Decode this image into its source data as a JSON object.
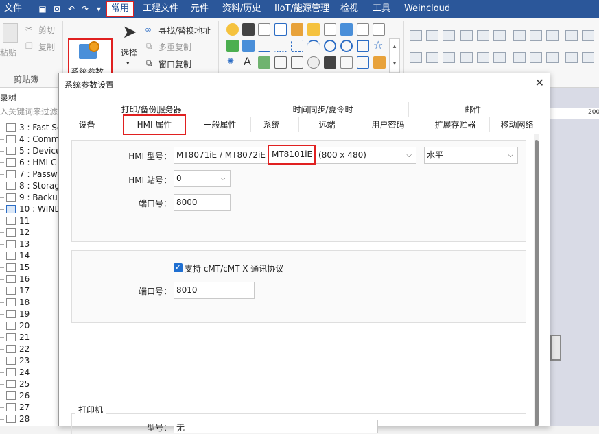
{
  "menubar": {
    "items": [
      "文件",
      "常用",
      "工程文件",
      "元件",
      "资料/历史",
      "IIoT/能源管理",
      "检视",
      "工具",
      "Weincloud"
    ]
  },
  "ribbon": {
    "clipboard": {
      "paste": "粘贴",
      "cut": "剪切",
      "copy": "复制",
      "group_label": "剪贴簿"
    },
    "system_params_button": "系统参数",
    "select_button": "选择",
    "find_replace": "寻找/替换地址",
    "multi_copy": "多重复制",
    "window_copy": "窗口复制"
  },
  "tree": {
    "title": "录树",
    "filter_placeholder": "入关键词来过滤窗",
    "items": [
      "3 : Fast Se",
      "4 : Comm",
      "5 : Device",
      "6 : HMI C",
      "7 : Passwo",
      "8 : Storag",
      "9 : Backup",
      "10 : WIND",
      "11",
      "12",
      "13",
      "14",
      "15",
      "16",
      "17",
      "18",
      "19",
      "20",
      "21",
      "22",
      "23",
      "24",
      "25",
      "26",
      "27",
      "28"
    ]
  },
  "ruler_number": "200",
  "dialog": {
    "title": "系统参数设置",
    "tabs_top": [
      "打印/备份服务器",
      "时间同步/夏令时",
      "邮件"
    ],
    "tabs_bottom": [
      "设备",
      "HMI 属性",
      "一般属性",
      "系统",
      "远端",
      "用户密码",
      "扩展存贮器",
      "移动网络"
    ],
    "hmi_model_label": "HMI 型号：",
    "hmi_model_value": "MT8071iE / MT8072iE / ",
    "hmi_model_highlight": "MT8101iE",
    "hmi_model_suffix": "(800 x 480)",
    "orientation_value": "水平",
    "station_label": "HMI 站号：",
    "station_value": "0",
    "port_label": "端口号：",
    "port_value": "8000",
    "cmt_checkbox_label": "支持 cMT/cMT X 通讯协议",
    "cmt_port_label": "端口号：",
    "cmt_port_value": "8010",
    "printer_group": "打印机",
    "printer_type_label": "型号：",
    "printer_type_value": "无"
  }
}
